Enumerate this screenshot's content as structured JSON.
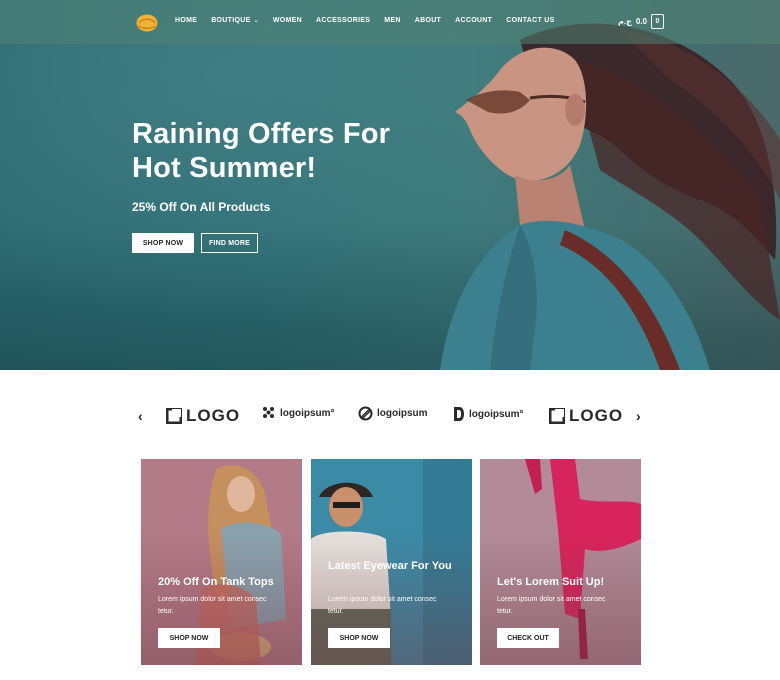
{
  "header": {
    "nav": [
      {
        "label": "HOME"
      },
      {
        "label": "BOUTIQUE",
        "has_dropdown": true
      },
      {
        "label": "WOMEN"
      },
      {
        "label": "ACCESSORIES"
      },
      {
        "label": "MEN"
      },
      {
        "label": "ABOUT"
      },
      {
        "label": "ACCOUNT"
      },
      {
        "label": "CONTACT US"
      }
    ],
    "cart_price": "0.0",
    "currency_symbol": "ج.م",
    "cart_count": "0"
  },
  "hero": {
    "title_line1": "Raining Offers For",
    "title_line2": "Hot Summer!",
    "subtitle": "25% Off On All Products",
    "primary_button": "SHOP NOW",
    "secondary_button": "FIND MORE"
  },
  "brands": [
    {
      "label": "LOGO",
      "style": "block"
    },
    {
      "label": "logoipsum°",
      "style": "dots"
    },
    {
      "label": "logoipsum",
      "style": "circle"
    },
    {
      "label": "logoipsum°",
      "style": "d"
    },
    {
      "label": "LOGO",
      "style": "block"
    }
  ],
  "cards": [
    {
      "title": "20% Off On Tank Tops",
      "desc_line1": "Lorem ipsum dolor sit amet consec",
      "desc_line2": "tetur.",
      "button": "SHOP NOW",
      "bg": "#b37a87"
    },
    {
      "title": "Latest Eyewear For You",
      "desc_line1": "Lorem ipsum dolor sit amet consec",
      "desc_line2": "tetur.",
      "button": "SHOP NOW",
      "bg": "#3b8aa6"
    },
    {
      "title": "Let's Lorem Suit Up!",
      "desc_line1": "Lorem ipsum dolor sit amet consec",
      "desc_line2": "tetur.",
      "button": "CHECK OUT",
      "bg": "#b28a98"
    }
  ],
  "colors": {
    "hero_teal": "#2f7077",
    "card_pink": "#b37a87",
    "card_blue": "#3b8aa6",
    "card_mauve": "#b28a98",
    "logo_yellow": "#f2b234"
  }
}
